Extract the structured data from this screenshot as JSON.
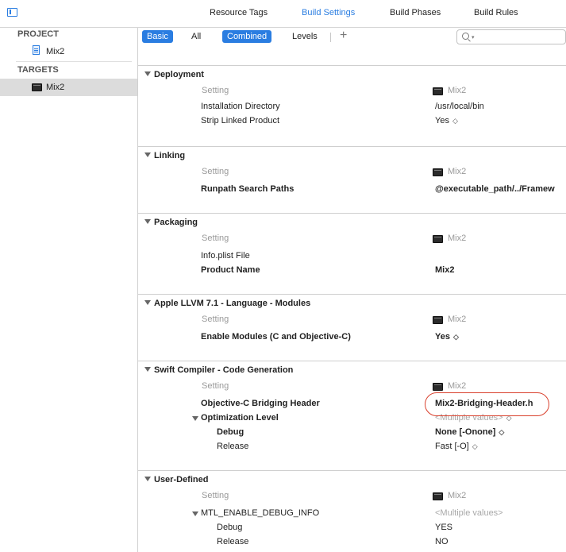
{
  "toolbar": {
    "tabs": [
      {
        "label": "Resource Tags"
      },
      {
        "label": "Build Settings",
        "active": true
      },
      {
        "label": "Build Phases"
      },
      {
        "label": "Build Rules"
      }
    ]
  },
  "sidebar": {
    "project_header": "PROJECT",
    "project_item": "Mix2",
    "targets_header": "TARGETS",
    "target_item": "Mix2"
  },
  "filters": {
    "basic": "Basic",
    "all": "All",
    "combined": "Combined",
    "levels": "Levels",
    "add": "+"
  },
  "table": {
    "col_setting": "Setting",
    "col_target": "Mix2"
  },
  "sections": [
    {
      "title": "Deployment",
      "rows": [
        {
          "name": "Installation Directory",
          "value": "/usr/local/bin"
        },
        {
          "name": "Strip Linked Product",
          "value": "Yes"
        }
      ]
    },
    {
      "title": "Linking",
      "rows": [
        {
          "name": "Runpath Search Paths",
          "value": "@executable_path/../Framew"
        }
      ]
    },
    {
      "title": "Packaging",
      "rows": [
        {
          "name": "Info.plist File",
          "value": ""
        },
        {
          "name": "Product Name",
          "value": "Mix2"
        }
      ]
    },
    {
      "title": "Apple LLVM 7.1 - Language - Modules",
      "rows": [
        {
          "name": "Enable Modules (C and Objective-C)",
          "value": "Yes"
        }
      ]
    },
    {
      "title": "Swift Compiler - Code Generation",
      "rows": [
        {
          "name": "Objective-C Bridging Header",
          "value": "Mix2-Bridging-Header.h"
        },
        {
          "name": "Optimization Level",
          "value": "<Multiple values>"
        },
        {
          "name": "Debug",
          "value": "None [-Onone]"
        },
        {
          "name": "Release",
          "value": "Fast [-O]"
        }
      ]
    },
    {
      "title": "User-Defined",
      "rows": [
        {
          "name": "MTL_ENABLE_DEBUG_INFO",
          "value": "<Multiple values>"
        },
        {
          "name": "Debug",
          "value": "YES"
        },
        {
          "name": "Release",
          "value": "NO"
        }
      ]
    }
  ],
  "colors": {
    "accent": "#2a7de1",
    "highlight_ring": "#d9412e",
    "selected_row": "#dcdcdc"
  }
}
